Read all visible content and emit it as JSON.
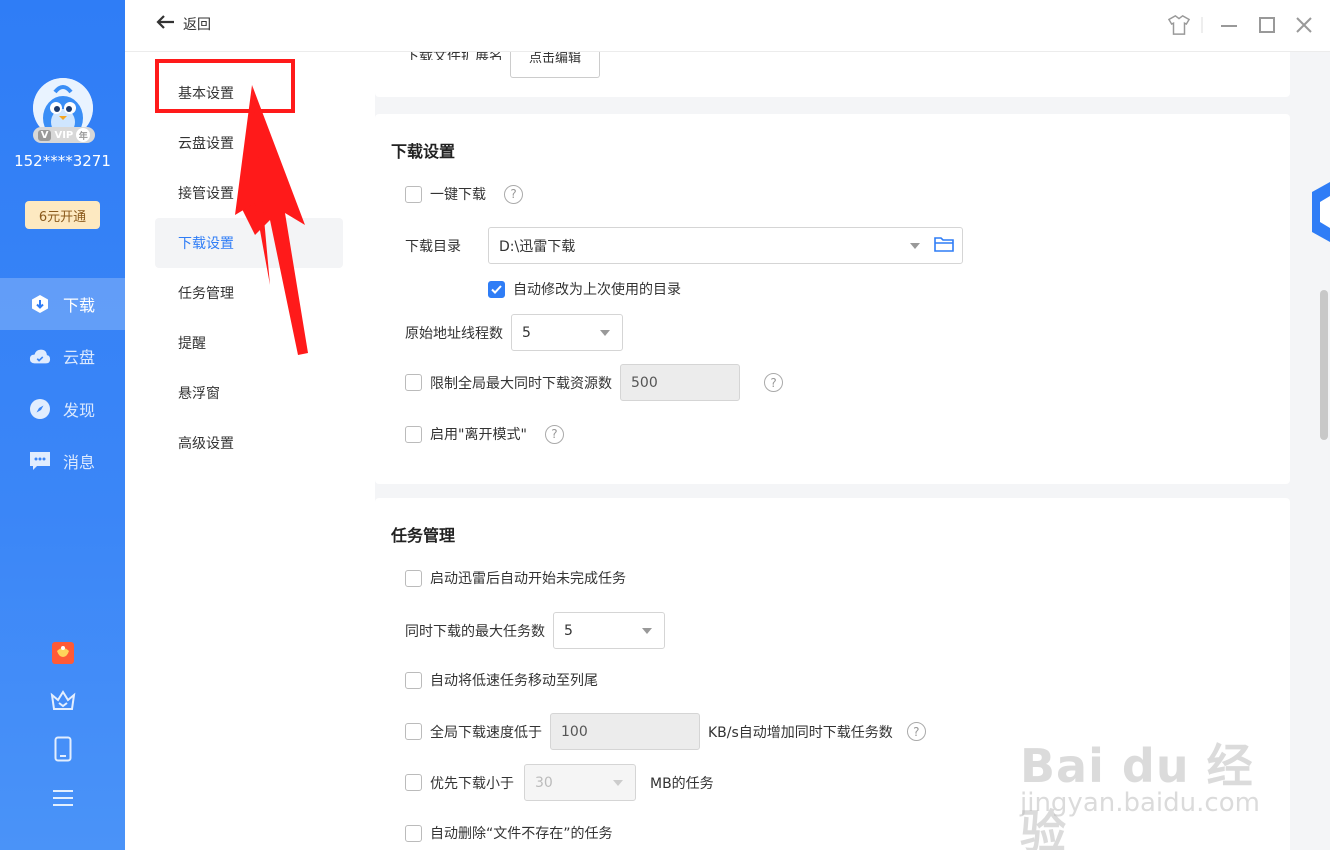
{
  "app": {
    "user": {
      "phone": "152****3271",
      "vip_label": "VIP",
      "vip_year": "年"
    },
    "open_vip_button": "6元开通",
    "nav": [
      {
        "label": "下载",
        "icon": "download-icon",
        "active": true
      },
      {
        "label": "云盘",
        "icon": "cloud-icon",
        "active": false
      },
      {
        "label": "发现",
        "icon": "compass-icon",
        "active": false
      },
      {
        "label": "消息",
        "icon": "message-icon",
        "active": false
      }
    ],
    "bottom_icons": [
      "gift-icon",
      "crown-icon",
      "phone-icon",
      "menu-icon"
    ],
    "accent_color": "#2f7df6"
  },
  "topbar": {
    "back_label": "返回"
  },
  "settings_menu": {
    "items": [
      {
        "label": "基本设置"
      },
      {
        "label": "云盘设置"
      },
      {
        "label": "接管设置"
      },
      {
        "label": "下载设置",
        "active": true
      },
      {
        "label": "任务管理"
      },
      {
        "label": "提醒"
      },
      {
        "label": "悬浮窗"
      },
      {
        "label": "高级设置"
      }
    ]
  },
  "partial_top": {
    "label": "下载文件扩展名",
    "button": "点击编辑"
  },
  "download_settings": {
    "title": "下载设置",
    "one_click": {
      "label": "一键下载",
      "checked": false
    },
    "dir": {
      "label": "下载目录",
      "value": "D:\\迅雷下载"
    },
    "auto_modify": {
      "label": "自动修改为上次使用的目录",
      "checked": true
    },
    "threads": {
      "label": "原始地址线程数",
      "value": "5"
    },
    "limit_sources": {
      "label": "限制全局最大同时下载资源数",
      "value": "500",
      "checked": false
    },
    "away_mode": {
      "label": "启用\"离开模式\"",
      "checked": false
    }
  },
  "task_management": {
    "title": "任务管理",
    "auto_start": {
      "label": "启动迅雷后自动开始未完成任务",
      "checked": false
    },
    "max_tasks": {
      "label": "同时下载的最大任务数",
      "value": "5"
    },
    "move_slow": {
      "label": "自动将低速任务移动至列尾",
      "checked": false
    },
    "speed_low": {
      "label": "全局下载速度低于",
      "value": "100",
      "suffix": "KB/s自动增加同时下载任务数",
      "checked": false
    },
    "priority_small": {
      "label": "优先下载小于",
      "value": "30",
      "suffix": "MB的任务",
      "checked": false
    },
    "auto_delete": {
      "label": "自动删除“文件不存在”的任务",
      "checked": false
    }
  },
  "watermark": {
    "main": "Bai du 经验",
    "sub": "jingyan.baidu.com"
  },
  "annotation_color": "#ff1a1a"
}
